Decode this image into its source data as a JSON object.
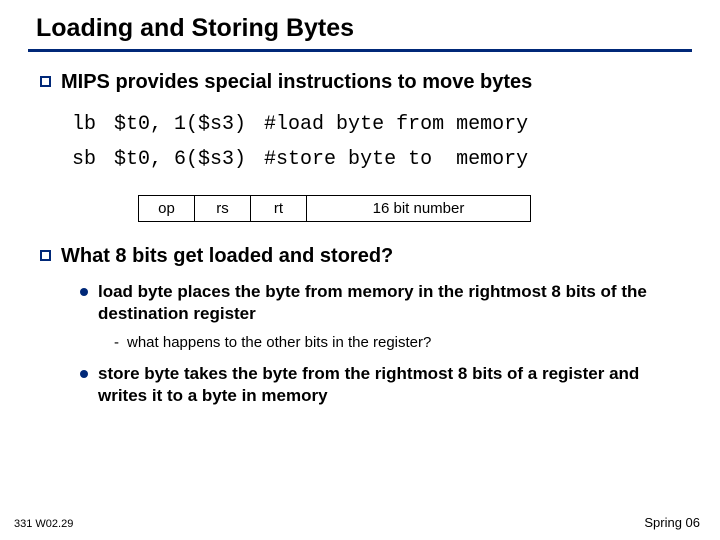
{
  "title": "Loading and Storing Bytes",
  "bullets": [
    {
      "text": "MIPS provides special instructions to move bytes"
    },
    {
      "text": "What 8 bits get loaded and stored?"
    }
  ],
  "code": {
    "rows": [
      {
        "mn": "lb",
        "args": "$t0, 1($s3)",
        "comment": "#load byte from memory"
      },
      {
        "mn": "sb",
        "args": "$t0, 6($s3)",
        "comment": "#store byte to  memory"
      }
    ]
  },
  "format": {
    "fields": [
      "op",
      "rs",
      "rt",
      "16 bit number"
    ]
  },
  "subs": [
    {
      "text": "load byte places the byte from memory in the rightmost 8 bits of the destination register"
    },
    {
      "text": "store byte takes the byte from the rightmost 8 bits of a register and writes it to a byte in memory"
    }
  ],
  "dash": {
    "text": "what happens to the other bits in the register?"
  },
  "footer": {
    "left": "331 W02.29",
    "right": "Spring 06"
  }
}
